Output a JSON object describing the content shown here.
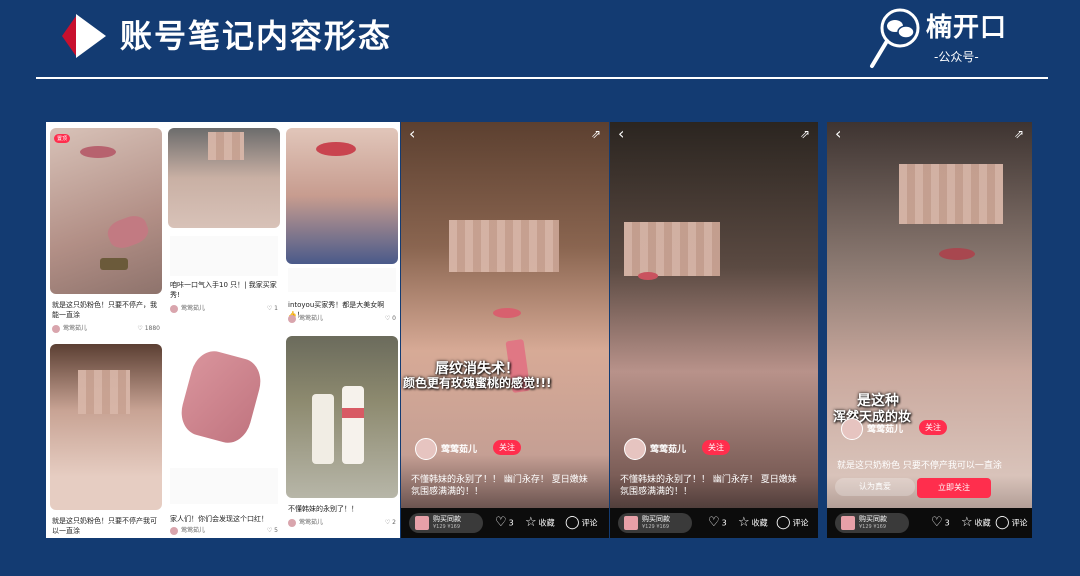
{
  "header": {
    "title": "账号笔记内容形态",
    "accent_red": "#c8102e",
    "background": "#133b72",
    "brand_name": "楠开口",
    "brand_sub": "-公众号-"
  },
  "feed": {
    "columns": [
      [
        {
          "tag": "置顶",
          "text": "就是这只奶粉色！只要不停产，我能一直涂",
          "author": "莺莺茹儿",
          "likes": "1880"
        },
        {
          "text": "就是这只奶粉色！只要不停产我可以一直涂"
        }
      ],
      [
        {
          "text": "咱咔一口气入手10 只！| 我家买家秀!",
          "author": "莺莺茹儿",
          "likes": "1"
        },
        {
          "text": "家人们！你们会发现这个口红！",
          "author": "莺莺茹儿",
          "likes": "5"
        }
      ],
      [
        {
          "text": "intoyou买家秀！都是大美女啊👍！",
          "author": "莺莺茹儿",
          "likes": "0"
        },
        {
          "text": "不懂韩妹的永别了！！",
          "author": "莺莺茹儿",
          "likes": "2"
        }
      ]
    ]
  },
  "videos": [
    {
      "caption_line1": "唇纹消失术！",
      "caption_line2": "颜色更有玫瑰蜜桃的感觉!!!",
      "username": "莺莺茹儿",
      "follow": "关注",
      "desc": "不懂韩妹的永别了！！ 幽门永存！ 夏日嫩妹氛围感满满的！！",
      "buy_label": "购买同款",
      "price": "¥129 ¥169",
      "likes": "3",
      "collect": "收藏",
      "comment": "评论"
    },
    {
      "username": "莺莺茹儿",
      "follow": "关注",
      "desc": "不懂韩妹的永别了！！ 幽门永存！ 夏日嫩妹氛围感满满的！！",
      "buy_label": "购买同款",
      "price": "¥129 ¥169",
      "likes": "3",
      "collect": "收藏",
      "comment": "评论"
    },
    {
      "caption_line1": "是这种",
      "caption_line2": "浑然天成的妆",
      "username": "莺莺茹儿",
      "follow": "关注",
      "desc": "就是这只奶粉色 只要不停产我可以一直涂",
      "buy_label": "购买同款",
      "price": "¥129 ¥169",
      "likes": "3",
      "collect": "收藏",
      "comment": "评论",
      "cta_left": "认为真爱",
      "cta_right": "立即关注"
    }
  ]
}
